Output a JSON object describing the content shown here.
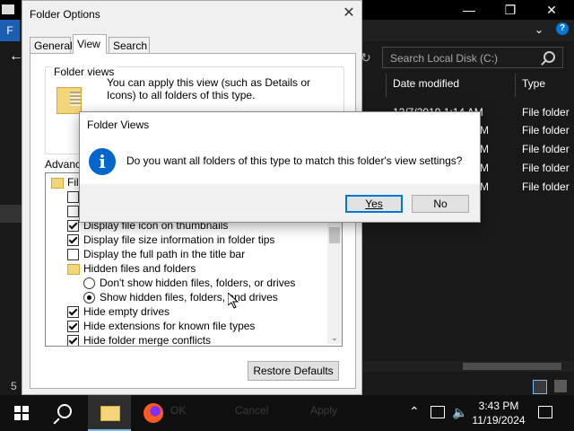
{
  "explorer": {
    "file_tab": "F",
    "search_placeholder": "Search Local Disk (C:)",
    "columns": [
      "Date modified",
      "Type"
    ],
    "partial_date": "12/7/2019 1:14 AM",
    "partial_letters": [
      "M",
      "M",
      "M",
      "M"
    ],
    "types": [
      "File folder",
      "File folder",
      "File folder",
      "File folder",
      "File folder"
    ],
    "status_count": "5"
  },
  "folder_options": {
    "title": "Folder Options",
    "tabs": [
      "General",
      "View",
      "Search"
    ],
    "active_tab": "View",
    "group_label": "Folder views",
    "group_text": "You can apply this view (such as Details or Icons) to all folders of this type.",
    "advanced_label": "Advance",
    "list_items": [
      {
        "kind": "folder",
        "label": "File",
        "indent": 0
      },
      {
        "kind": "checkbox",
        "checked": false,
        "label": "",
        "indent": 1
      },
      {
        "kind": "checkbox",
        "checked": false,
        "label": "",
        "indent": 1
      },
      {
        "kind": "checkbox",
        "checked": true,
        "label": "Display file icon on thumbnails",
        "indent": 1
      },
      {
        "kind": "checkbox",
        "checked": true,
        "label": "Display file size information in folder tips",
        "indent": 1
      },
      {
        "kind": "checkbox",
        "checked": false,
        "label": "Display the full path in the title bar",
        "indent": 1
      },
      {
        "kind": "folder",
        "label": "Hidden files and folders",
        "indent": 1
      },
      {
        "kind": "radio",
        "checked": false,
        "label": "Don't show hidden files, folders, or drives",
        "indent": 2
      },
      {
        "kind": "radio",
        "checked": true,
        "label": "Show hidden files, folders, and drives",
        "indent": 2
      },
      {
        "kind": "checkbox",
        "checked": true,
        "label": "Hide empty drives",
        "indent": 1
      },
      {
        "kind": "checkbox",
        "checked": true,
        "label": "Hide extensions for known file types",
        "indent": 1
      },
      {
        "kind": "checkbox",
        "checked": true,
        "label": "Hide folder merge conflicts",
        "indent": 1
      }
    ],
    "restore_defaults": "Restore Defaults"
  },
  "message_box": {
    "title": "Folder Views",
    "text": "Do you want all folders of this type to match this folder's view settings?",
    "yes": "Yes",
    "no": "No"
  },
  "taskbar": {
    "items_faded": [
      "OK",
      "Cancel",
      "Apply"
    ],
    "time": "3:43 PM",
    "date": "11/19/2024"
  }
}
